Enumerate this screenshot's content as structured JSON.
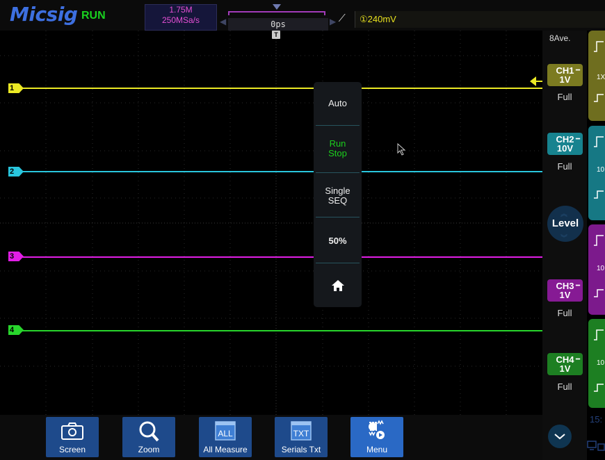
{
  "topbar": {
    "logo": "Micsig",
    "run_status": "RUN",
    "memory_depth": "1.75M",
    "sample_rate": "250MSa/s",
    "horizontal_offset": "0ps",
    "trigger_level": "①240mV"
  },
  "waveform": {
    "trigger_marker": "T",
    "channels": [
      {
        "id": "1",
        "color": "#ecea24"
      },
      {
        "id": "2",
        "color": "#29c6de"
      },
      {
        "id": "3",
        "color": "#e21ee6"
      },
      {
        "id": "4",
        "color": "#28d62c"
      }
    ]
  },
  "run_menu": {
    "auto": "Auto",
    "run": "Run",
    "stop": "Stop",
    "single": "Single",
    "seq": "SEQ",
    "fifty": "50%"
  },
  "bottombar": {
    "screen": "Screen",
    "zoom": "Zoom",
    "all_measure": "All Measure",
    "all_icon_text": "ALL",
    "serials": "Serials Txt",
    "txt_icon_text": "TXT",
    "menu": "Menu"
  },
  "right_panel": {
    "acquisition_mode": "8Ave.",
    "ch1": {
      "name": "CH1",
      "scale": "1V",
      "coupling": "Full"
    },
    "ch2": {
      "name": "CH2",
      "scale": "10V",
      "coupling": "Full"
    },
    "ch3": {
      "name": "CH3",
      "scale": "1V",
      "coupling": "Full"
    },
    "ch4": {
      "name": "CH4",
      "scale": "1V",
      "coupling": "Full"
    },
    "level_label": "Level"
  },
  "strip": {
    "ch1_probe": "1X",
    "ch2_probe": "10",
    "ch3_probe": "10",
    "ch4_probe": "10",
    "clock": "15:"
  }
}
